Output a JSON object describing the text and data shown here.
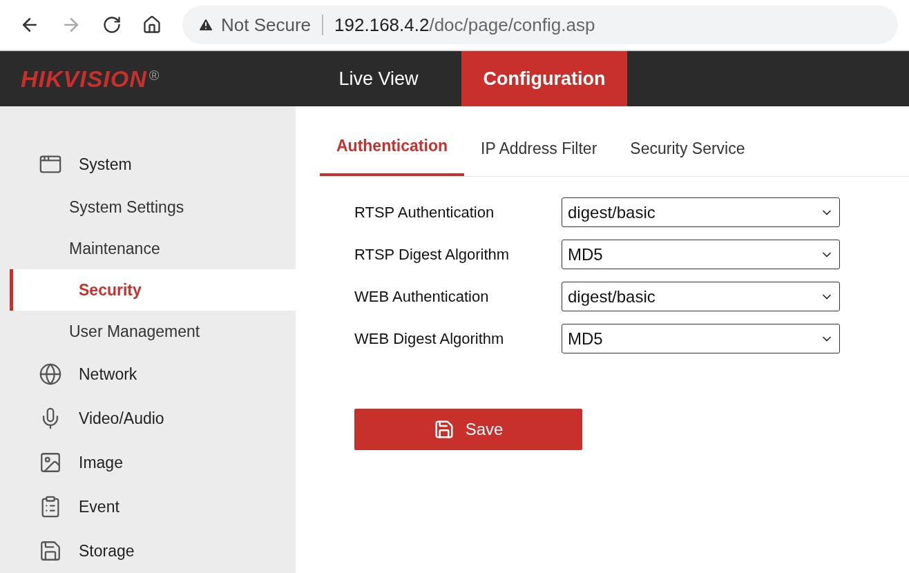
{
  "browser": {
    "back_disabled": false,
    "forward_disabled": true,
    "security": "Not Secure",
    "url_host": "192.168.4.2",
    "url_path": "/doc/page/config.asp"
  },
  "header": {
    "logo": "HIKVISION",
    "logo_mark": "®",
    "nav": [
      {
        "label": "Live View",
        "selected": false
      },
      {
        "label": "Configuration",
        "selected": true
      }
    ]
  },
  "sidebar": {
    "items": [
      {
        "label": "System",
        "children": [
          {
            "label": "System Settings",
            "selected": false
          },
          {
            "label": "Maintenance",
            "selected": false
          },
          {
            "label": "Security",
            "selected": true
          },
          {
            "label": "User Management",
            "selected": false
          }
        ]
      },
      {
        "label": "Network"
      },
      {
        "label": "Video/Audio"
      },
      {
        "label": "Image"
      },
      {
        "label": "Event"
      },
      {
        "label": "Storage"
      }
    ]
  },
  "tabs": [
    {
      "label": "Authentication",
      "selected": true
    },
    {
      "label": "IP Address Filter",
      "selected": false
    },
    {
      "label": "Security Service",
      "selected": false
    }
  ],
  "fields": [
    {
      "label": "RTSP Authentication",
      "value": "digest/basic"
    },
    {
      "label": "RTSP Digest Algorithm",
      "value": "MD5"
    },
    {
      "label": "WEB Authentication",
      "value": "digest/basic"
    },
    {
      "label": "WEB Digest Algorithm",
      "value": "MD5"
    }
  ],
  "save_button": "Save"
}
